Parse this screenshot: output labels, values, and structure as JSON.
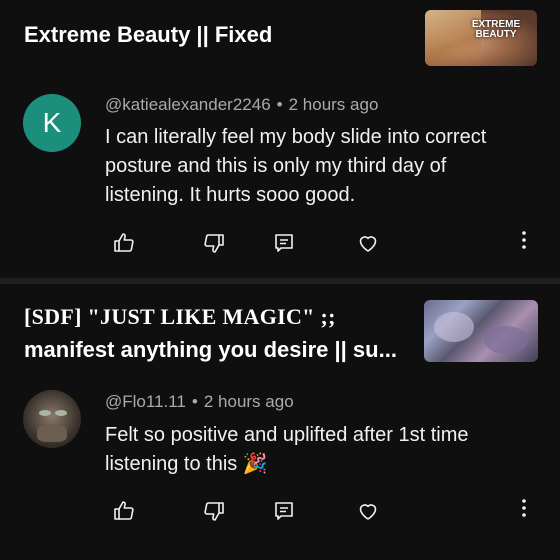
{
  "comments": [
    {
      "video_title": "Extreme Beauty || Fixed",
      "thumbnail_text": "EXTREME BEAUTY",
      "avatar_letter": "K",
      "avatar_color": "#1c8f7c",
      "author": "@katiealexander2246",
      "time": "2 hours ago",
      "text": "I can literally feel my body slide into correct posture and this is only my third day of listening. It hurts sooo good."
    },
    {
      "video_title_part1": "[SDF] \"JUST LIKE MAGIC\" ;;",
      "video_title_part2": "manifest anything you desire || su...",
      "author": "@Flo11.11",
      "time": "2 hours ago",
      "text": "Felt so positive and uplifted after 1st time listening to this 🎉"
    }
  ],
  "separator": "•",
  "icons": [
    "thumbs-up-icon",
    "thumbs-down-icon",
    "reply-icon",
    "heart-icon",
    "more-vertical-icon"
  ],
  "colors": {
    "background": "#0f0f0f",
    "text": "#f1f1f1",
    "meta": "#aaaaaa"
  }
}
